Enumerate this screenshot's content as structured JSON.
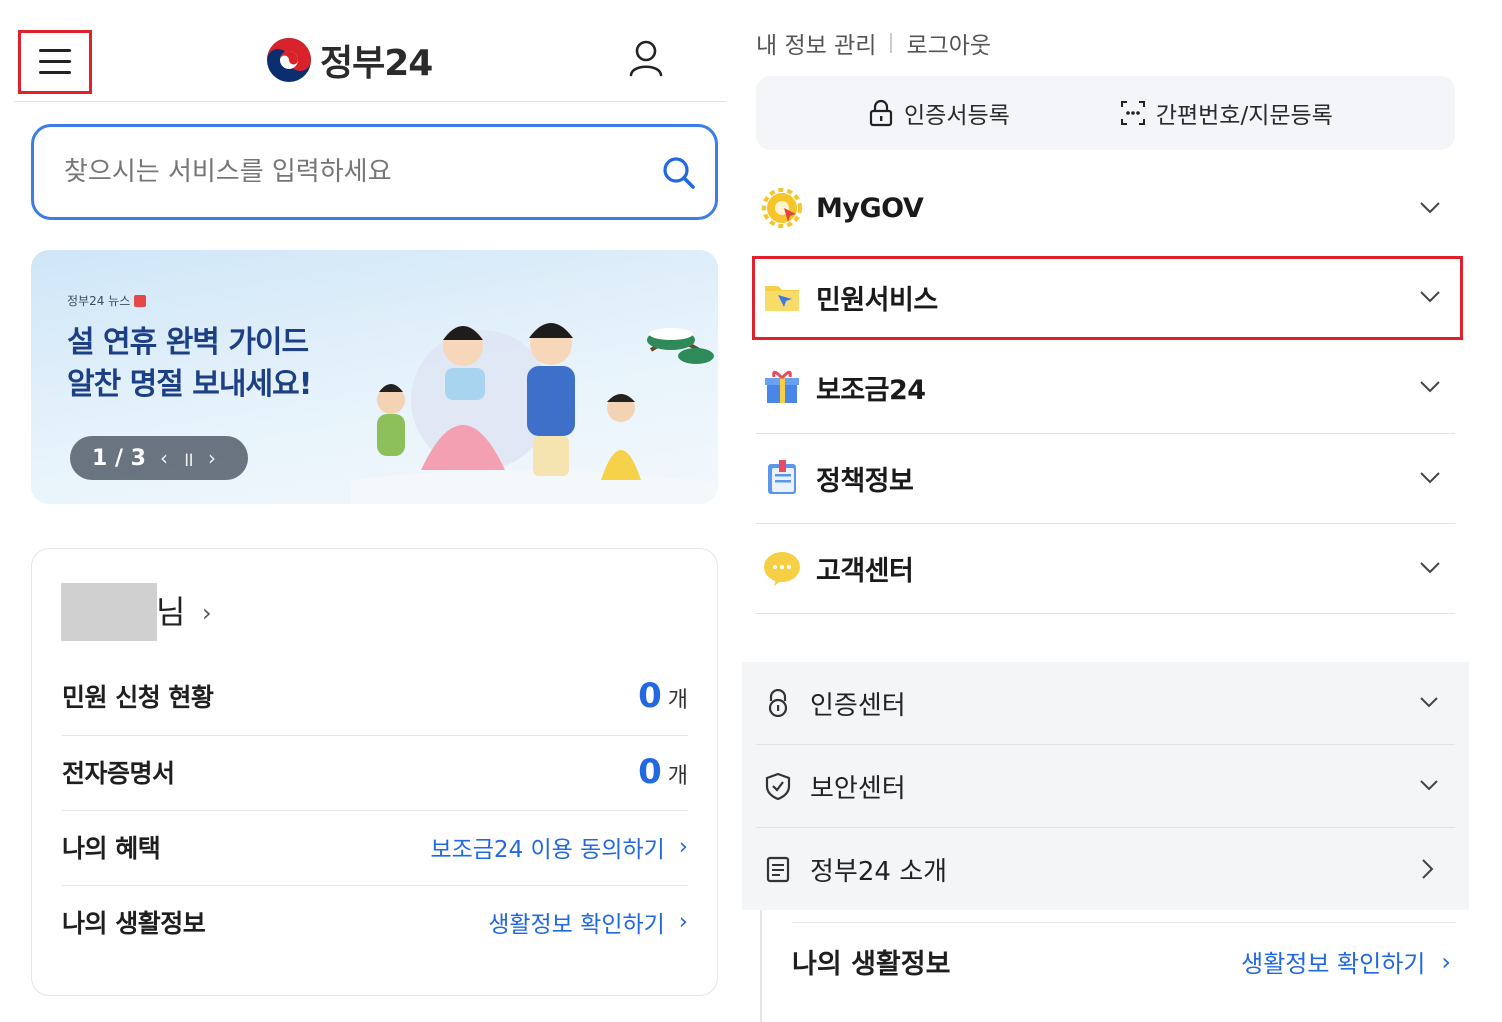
{
  "app": {
    "name": "정부24"
  },
  "search": {
    "placeholder": "찾으시는 서비스를 입력하세요"
  },
  "banner": {
    "tag": "정부24 뉴스",
    "headline_line1": "설 연휴 완벽 가이드",
    "headline_line2": "알찬 명절 보내세요!",
    "pager": "1 / 3"
  },
  "user_card": {
    "name_suffix": "님",
    "rows": [
      {
        "label": "민원 신청 현황",
        "count": "0",
        "unit": "개"
      },
      {
        "label": "전자증명서",
        "count": "0",
        "unit": "개"
      },
      {
        "label": "나의 혜택",
        "link": "보조금24 이용 동의하기"
      },
      {
        "label": "나의 생활정보",
        "link": "생활정보 확인하기"
      }
    ]
  },
  "side_menu": {
    "top_links": [
      "내 정보 관리",
      "로그아웃"
    ],
    "auth_buttons": [
      "인증서등록",
      "간편번호/지문등록"
    ],
    "main_items": [
      "MyGOV",
      "민원서비스",
      "보조금24",
      "정책정보",
      "고객센터"
    ],
    "sub_items": [
      "인증센터",
      "보안센터",
      "정부24 소개"
    ],
    "peek": {
      "label": "나의 생활정보",
      "link": "생활정보 확인하기"
    }
  },
  "colors": {
    "accent_blue": "#2268e0",
    "search_border": "#3d7ee6",
    "highlight_red": "#e0202a",
    "banner_headline": "#1d3f86"
  }
}
